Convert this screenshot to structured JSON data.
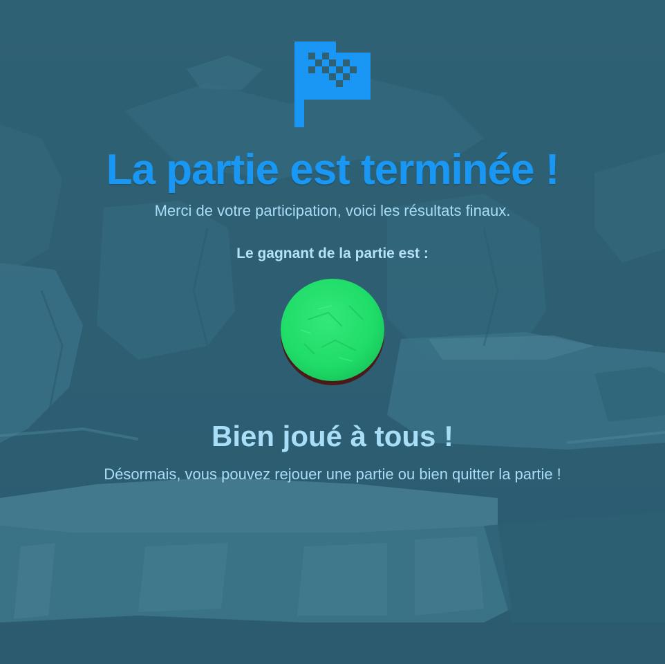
{
  "screen": {
    "title": "La partie est terminée !",
    "subtitle": "Merci de votre participation, voici les résultats finaux.",
    "winner_label": "Le gagnant de la partie est :",
    "congrats": "Bien joué à tous !",
    "info": "Désormais, vous pouvez rejouer une partie ou bien quitter la partie !"
  },
  "icons": {
    "flag": "checkered-flag-icon",
    "winner_token": "green-token"
  },
  "colors": {
    "background": "#2f6075",
    "title": "#1897f5",
    "flag": "#1a96f4",
    "text": "#a9ddf7",
    "winner_token": "#1fe06c"
  }
}
